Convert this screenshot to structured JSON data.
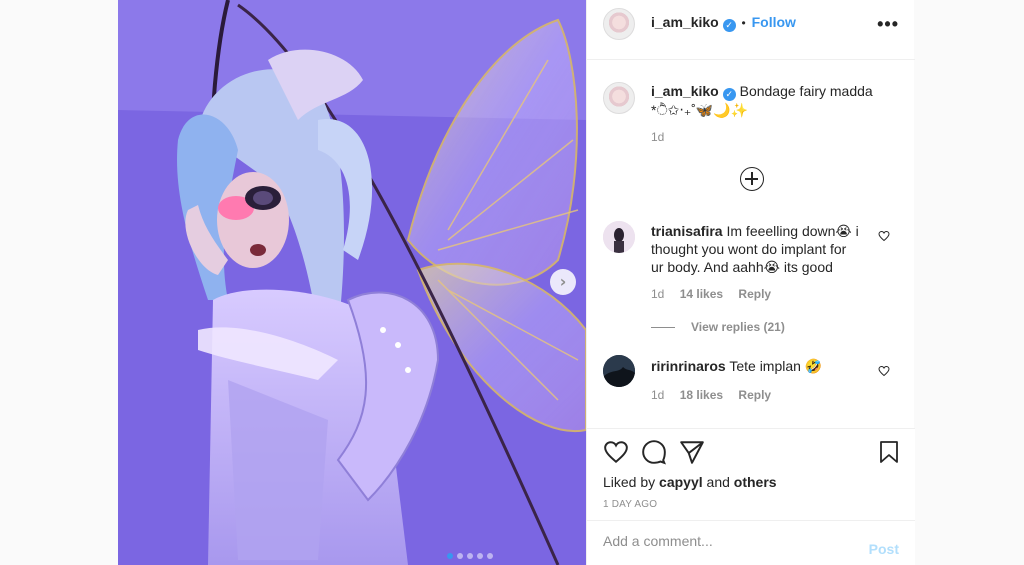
{
  "post": {
    "username": "i_am_kiko",
    "verified_mark": "✓",
    "separator": "•",
    "follow_label": "Follow",
    "more_label": "•••",
    "icons": {
      "more": "more-options-icon",
      "verified": "verified-badge-icon",
      "next": "chevron-right-icon",
      "like": "heart-icon",
      "comment": "comment-bubble-icon",
      "share": "paper-plane-icon",
      "save": "bookmark-icon",
      "load_more": "plus-circle-icon"
    },
    "colors": {
      "accent": "#3897f0",
      "post_disabled": "#b2dffc",
      "muted": "#8e8e8e"
    }
  },
  "caption": {
    "username": "i_am_kiko",
    "text": "Bondage fairy madda *ੈ✩‧₊˚🦋🌙✨",
    "time": "1d"
  },
  "comments": [
    {
      "username": "trianisafira",
      "text": "Im feeelling down😭 i thought you wont do implant for ur body. And aahh😭 its good",
      "time": "1d",
      "likes": "14 likes",
      "reply": "Reply",
      "view_replies": "View replies (21)"
    },
    {
      "username": "ririnrinaros",
      "text": "Tete implan 🤣",
      "time": "1d",
      "likes": "18 likes",
      "reply": "Reply"
    }
  ],
  "likes": {
    "prefix": "Liked by",
    "user": "capyyl",
    "and": "and",
    "others": "others"
  },
  "timestamp": "1 DAY AGO",
  "composer": {
    "placeholder": "Add a comment...",
    "post_label": "Post"
  },
  "carousel": {
    "total": 5,
    "current": 1,
    "next_label": "›"
  }
}
